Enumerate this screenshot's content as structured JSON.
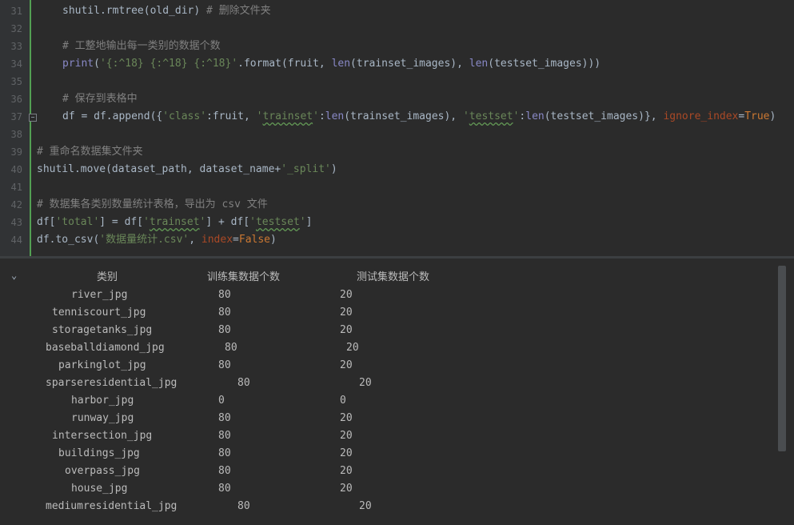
{
  "editor": {
    "line_numbers": [
      "31",
      "32",
      "33",
      "34",
      "35",
      "36",
      "37",
      "38",
      "39",
      "40",
      "41",
      "42",
      "43",
      "44"
    ],
    "lines": {
      "l31": {
        "code": "shutil.rmtree(old_dir) ",
        "comment": "# 删除文件夹"
      },
      "l33": {
        "comment": "# 工整地输出每一类别的数据个数"
      },
      "l34": {
        "print": "print",
        "p1": "(",
        "fmt": "'{:^18} {:^18} {:^18}'",
        "p2": ".format(fruit, ",
        "len1": "len",
        "p3": "(trainset_images), ",
        "len2": "len",
        "p4": "(testset_images)))"
      },
      "l36": {
        "comment": "# 保存到表格中"
      },
      "l37": {
        "a": "df = df.append({",
        "s1": "'class'",
        "b": ":fruit, ",
        "s2a": "'",
        "s2b": "trainset",
        "s2c": "'",
        "c": ":",
        "len1": "len",
        "d": "(trainset_images), ",
        "s3a": "'",
        "s3b": "testset",
        "s3c": "'",
        "e": ":",
        "len2": "len",
        "f": "(testset_images)}, ",
        "param": "ignore_index",
        "g": "=",
        "kw": "True",
        "h": ")"
      },
      "l39": {
        "comment": "# 重命名数据集文件夹"
      },
      "l40": {
        "a": "shutil.move(dataset_path, dataset_name+",
        "s": "'_split'",
        "b": ")"
      },
      "l42": {
        "comment": "# 数据集各类别数量统计表格，导出为 csv 文件"
      },
      "l43": {
        "a": "df[",
        "s1": "'total'",
        "b": "] = df[",
        "s2a": "'",
        "s2b": "trainset",
        "s2c": "'",
        "c": "] + df[",
        "s3a": "'",
        "s3b": "testset",
        "s3c": "'",
        "d": "]"
      },
      "l44": {
        "a": "df.to_csv(",
        "s": "'数据量统计.csv'",
        "b": ", ",
        "param": "index",
        "c": "=",
        "kw": "False",
        "d": ")"
      }
    }
  },
  "console": {
    "header": {
      "c1": "类别",
      "c2": "训练集数据个数",
      "c3": "测试集数据个数"
    },
    "rows": [
      {
        "name": "river_jpg",
        "train": "80",
        "test": "20"
      },
      {
        "name": "tenniscourt_jpg",
        "train": "80",
        "test": "20"
      },
      {
        "name": "storagetanks_jpg",
        "train": "80",
        "test": "20"
      },
      {
        "name": "baseballdiamond_jpg",
        "train": "80",
        "test": "20"
      },
      {
        "name": "parkinglot_jpg",
        "train": "80",
        "test": "20"
      },
      {
        "name": "sparseresidential_jpg",
        "train": "80",
        "test": "20"
      },
      {
        "name": "harbor_jpg",
        "train": "0",
        "test": "0"
      },
      {
        "name": "runway_jpg",
        "train": "80",
        "test": "20"
      },
      {
        "name": "intersection_jpg",
        "train": "80",
        "test": "20"
      },
      {
        "name": "buildings_jpg",
        "train": "80",
        "test": "20"
      },
      {
        "name": "overpass_jpg",
        "train": "80",
        "test": "20"
      },
      {
        "name": "house_jpg",
        "train": "80",
        "test": "20"
      },
      {
        "name": "mediumresidential_jpg",
        "train": "80",
        "test": "20"
      }
    ]
  }
}
